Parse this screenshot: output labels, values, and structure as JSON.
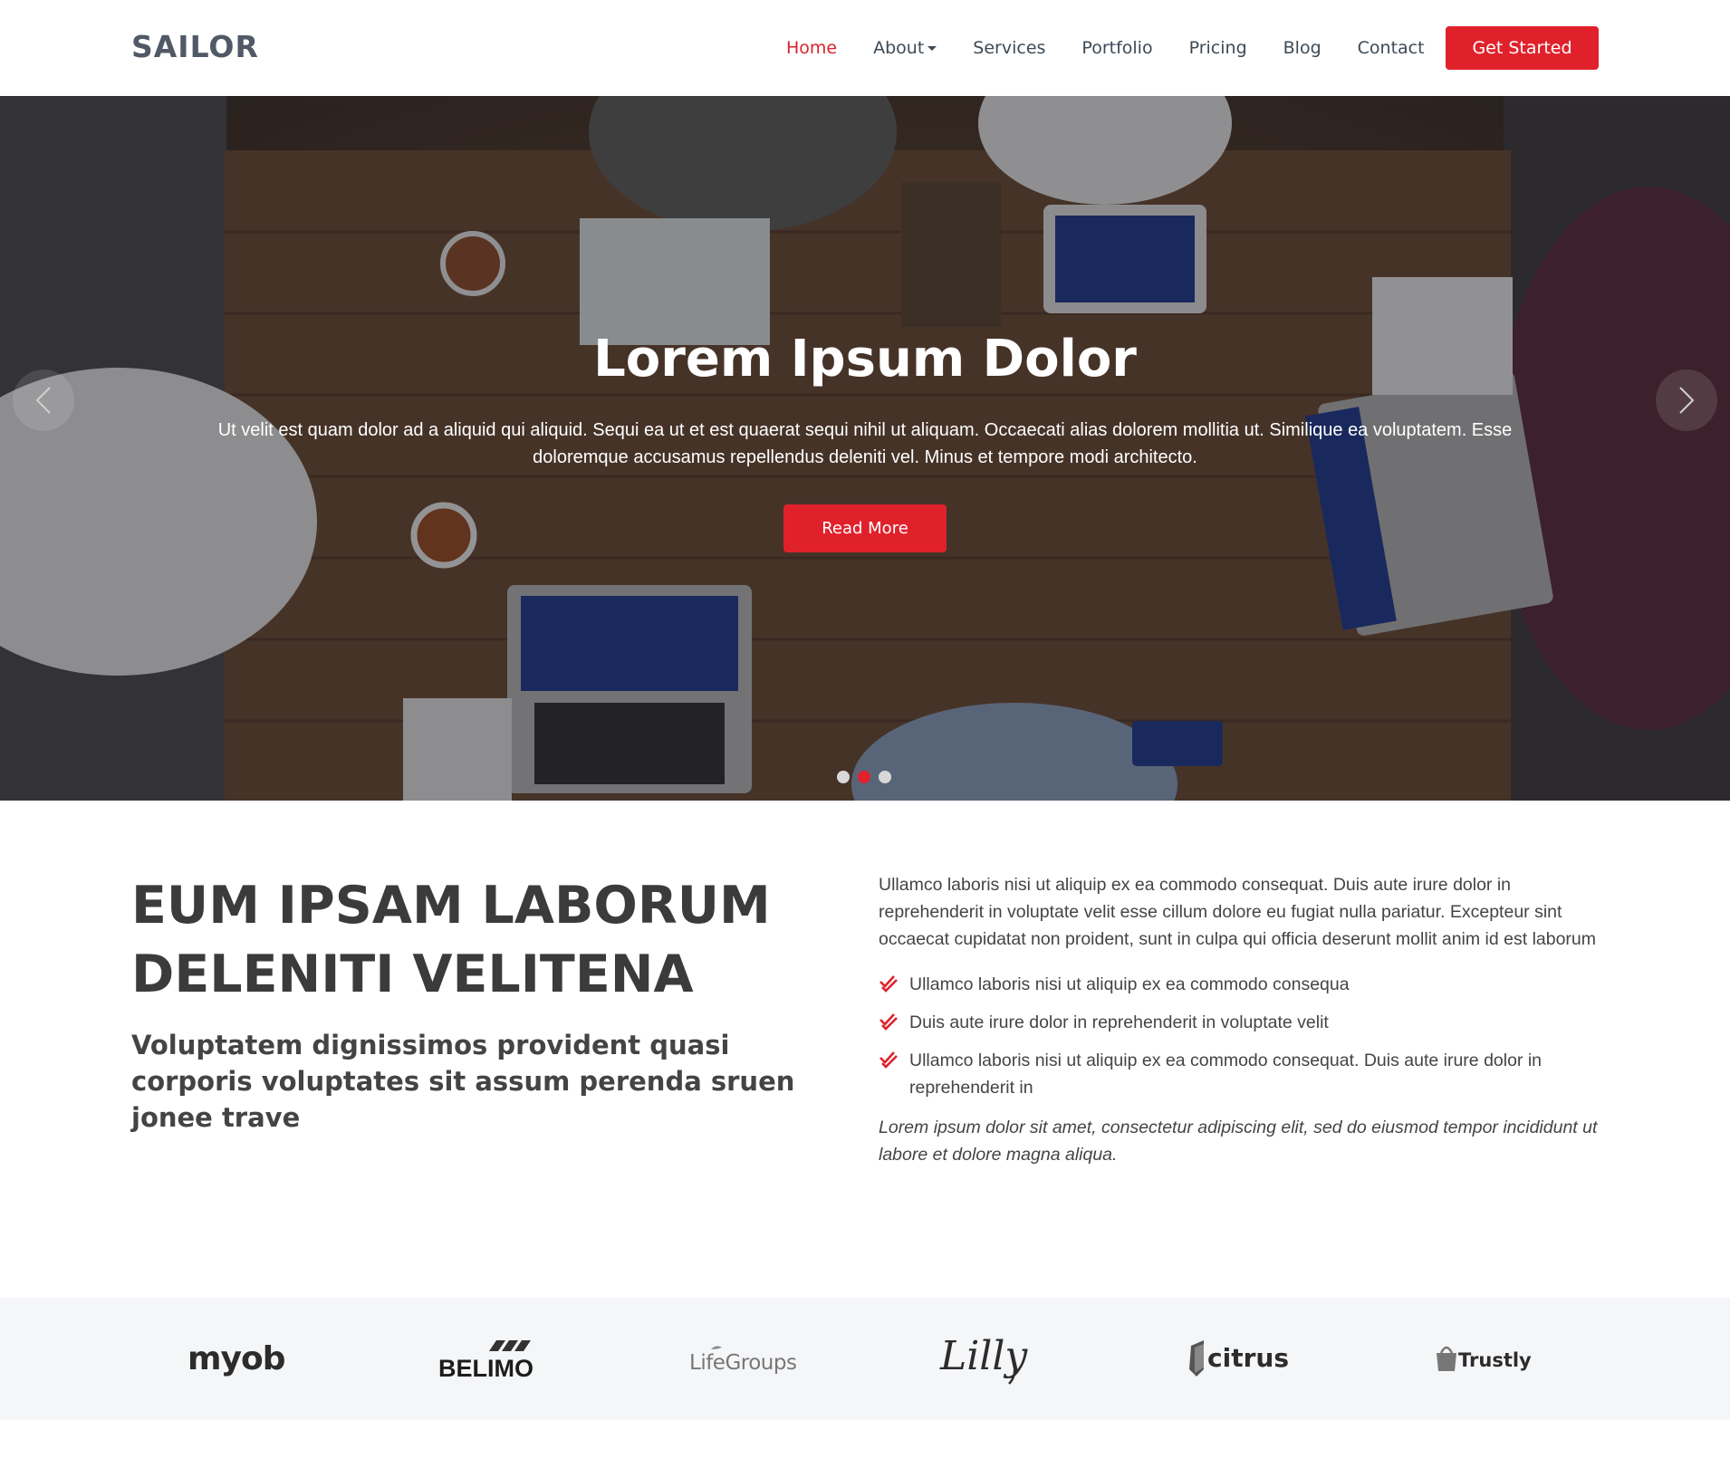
{
  "header": {
    "logo": "SAILOR",
    "nav": [
      {
        "label": "Home",
        "active": true
      },
      {
        "label": "About",
        "dropdown": true
      },
      {
        "label": "Services"
      },
      {
        "label": "Portfolio"
      },
      {
        "label": "Pricing"
      },
      {
        "label": "Blog"
      },
      {
        "label": "Contact"
      }
    ],
    "cta_label": "Get Started"
  },
  "hero": {
    "title": "Lorem Ipsum Dolor",
    "text": "Ut velit est quam dolor ad a aliquid qui aliquid. Sequi ea ut et est quaerat sequi nihil ut aliquam. Occaecati alias dolorem mollitia ut. Similique ea voluptatem. Esse doloremque accusamus repellendus deleniti vel. Minus et tempore modi architecto.",
    "button_label": "Read More",
    "slide_count": 3,
    "active_slide": 2
  },
  "about": {
    "heading_line1": "EUM IPSAM LABORUM",
    "heading_line2": "DELENITI VELITENA",
    "subheading": "Voluptatem dignissimos provident quasi corporis voluptates sit assum perenda sruen jonee trave",
    "paragraph": "Ullamco laboris nisi ut aliquip ex ea commodo consequat. Duis aute irure dolor in reprehenderit in voluptate velit esse cillum dolore eu fugiat nulla pariatur. Excepteur sint occaecat cupidatat non proident, sunt in culpa qui officia deserunt mollit anim id est laborum",
    "checklist": [
      "Ullamco laboris nisi ut aliquip ex ea commodo consequa",
      "Duis aute irure dolor in reprehenderit in voluptate velit",
      "Ullamco laboris nisi ut aliquip ex ea commodo consequat. Duis aute irure dolor in reprehenderit in"
    ],
    "italic": "Lorem ipsum dolor sit amet, consectetur adipiscing elit, sed do eiusmod tempor incididunt ut labore et dolore magna aliqua."
  },
  "clients": [
    "myob",
    "BELIMO",
    "LifeGroups",
    "Lilly",
    "citrus",
    "Trustly"
  ],
  "colors": {
    "accent": "#e0212b",
    "text": "#444444",
    "logo": "#505965",
    "clients_bg": "#f5f6f8"
  }
}
